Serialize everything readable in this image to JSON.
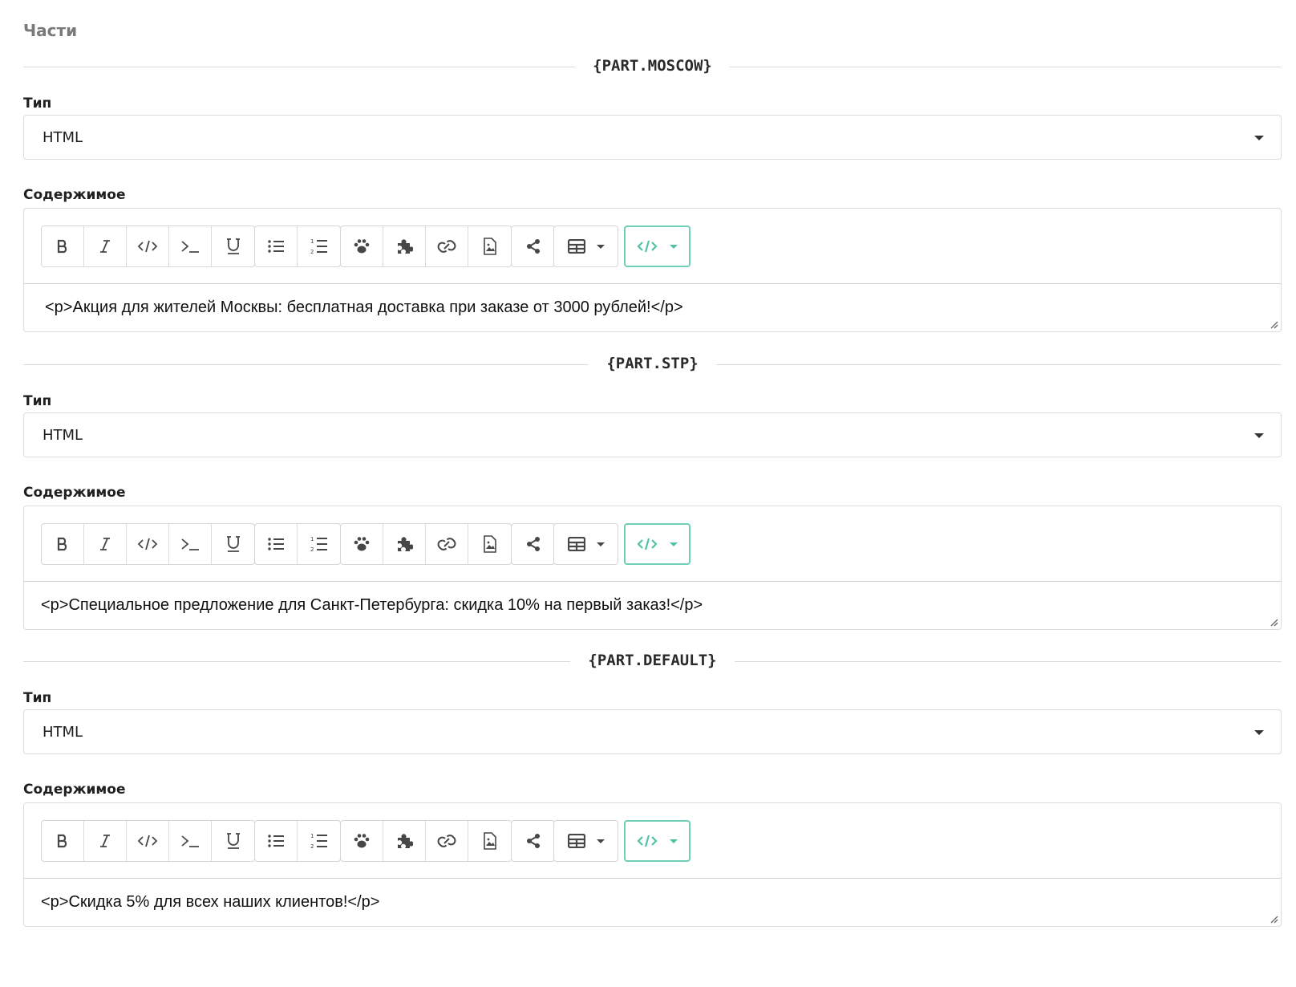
{
  "section_title": "Части",
  "parts": [
    {
      "name": "{PART.MOSCOW}",
      "type_label": "Тип",
      "type_value": "HTML",
      "content_label": "Содержимое",
      "content": "<p>Акция для жителей Москвы: бесплатная доставка при заказе от 3000 рублей!</p>"
    },
    {
      "name": "{PART.STP}",
      "type_label": "Тип",
      "type_value": "HTML",
      "content_label": "Содержимое",
      "content": "<p>Специальное предложение для Санкт-Петербурга: скидка 10% на первый заказ!</p>"
    },
    {
      "name": "{PART.DEFAULT}",
      "type_label": "Тип",
      "type_value": "HTML",
      "content_label": "Содержимое",
      "content": "<p>Скидка 5% для всех наших клиентов!</p>"
    }
  ],
  "toolbar": {
    "icons": [
      "bold-icon",
      "italic-icon",
      "code-icon",
      "terminal-icon",
      "underline-icon",
      "bullet-list-icon",
      "numbered-list-icon",
      "paw-icon",
      "puzzle-icon",
      "link-icon",
      "image-file-icon",
      "share-icon",
      "table-icon",
      "source-code-icon"
    ],
    "accent_color": "#52c2a4"
  }
}
